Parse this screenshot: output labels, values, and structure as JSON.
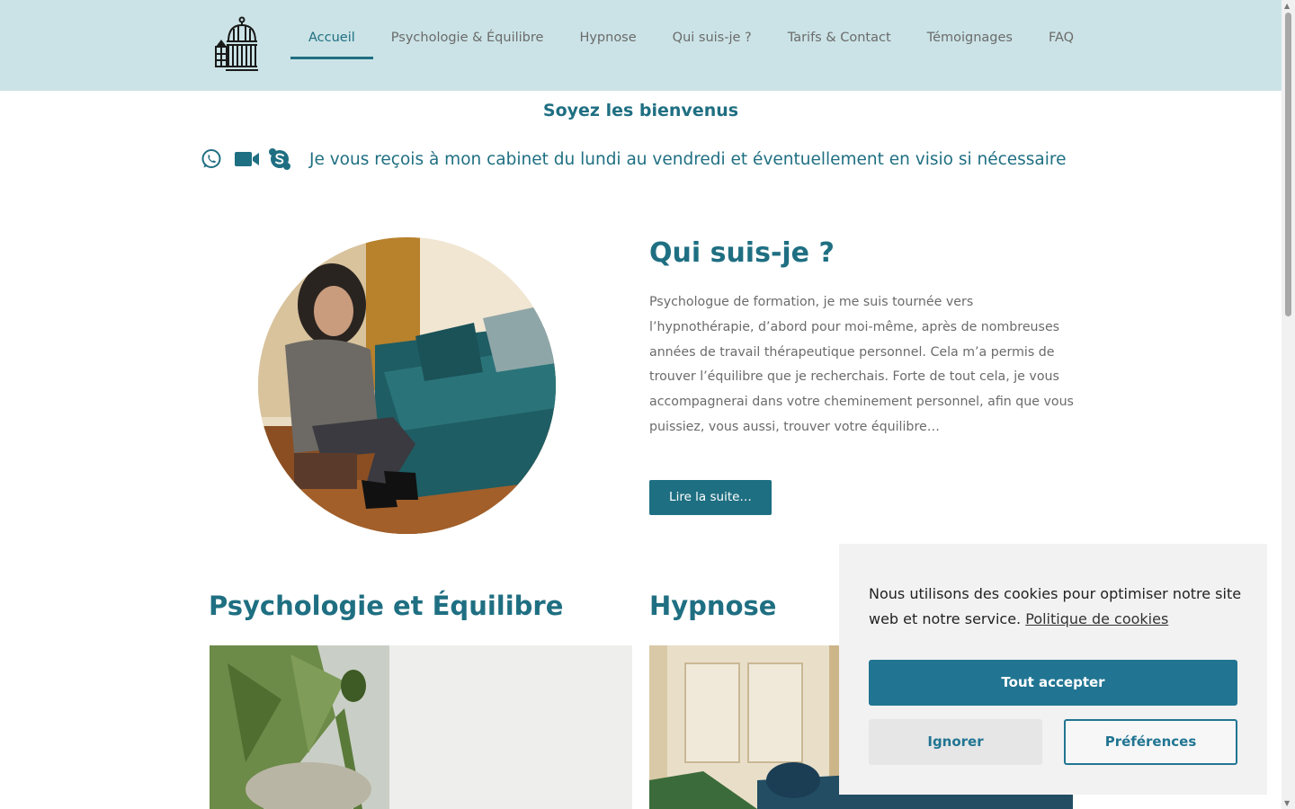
{
  "header": {
    "logo": "birdcage-logo",
    "nav": [
      {
        "label": "Accueil",
        "active": true
      },
      {
        "label": "Psychologie & Équilibre",
        "active": false
      },
      {
        "label": "Hypnose",
        "active": false
      },
      {
        "label": "Qui suis-je ?",
        "active": false
      },
      {
        "label": "Tarifs & Contact",
        "active": false
      },
      {
        "label": "Témoignages",
        "active": false
      },
      {
        "label": "FAQ",
        "active": false
      }
    ]
  },
  "welcome": "Soyez les bienvenus",
  "contact": {
    "icons": [
      "whatsapp-icon",
      "video-camera-icon",
      "skype-icon"
    ],
    "text": "Je vous reçois à mon cabinet du lundi au vendredi et éventuellement en visio si nécessaire"
  },
  "about": {
    "title": "Qui suis-je ?",
    "text": "Psychologue de formation, je me suis tournée vers l’hypnothérapie, d’abord pour moi-même, après de nombreuses années de travail thérapeutique personnel. Cela m’a permis de trouver l’équilibre que je recherchais. Forte de tout cela, je vous accompagnerai dans votre cheminement personnel, afin que vous puissiez, vous aussi, trouver votre équilibre…",
    "button": "Lire la suite…"
  },
  "sections": [
    {
      "title": "Psychologie et Équilibre"
    },
    {
      "title": "Hypnose"
    }
  ],
  "cookie": {
    "text": "Nous utilisons des cookies pour optimiser notre site web et notre service.",
    "link": "Politique de cookies",
    "accept": "Tout accepter",
    "ignore": "Ignorer",
    "preferences": "Préférences"
  },
  "colors": {
    "header_bg": "#cbe3e6",
    "accent": "#1f6f82",
    "button": "#217592"
  }
}
